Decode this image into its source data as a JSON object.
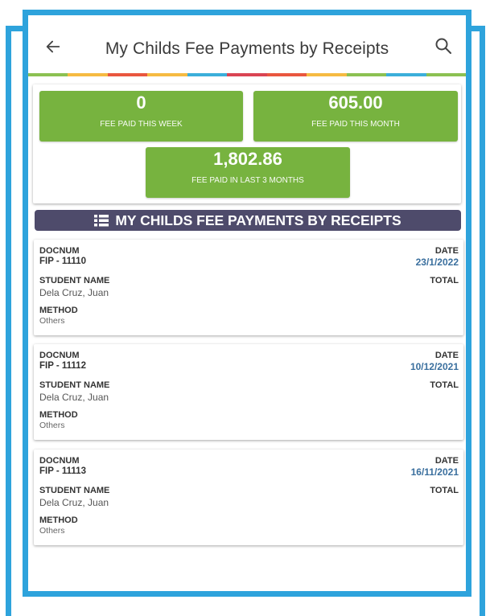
{
  "header": {
    "title": "My Childs Fee Payments by Receipts",
    "back_icon": "arrow-left-icon",
    "search_icon": "search-icon"
  },
  "stripe_colors": [
    "#8cc152",
    "#f6bb42",
    "#e9573f",
    "#f6bb42",
    "#3bafda",
    "#da4453",
    "#e9573f",
    "#f6bb42",
    "#8cc152",
    "#3bafda",
    "#8cc152"
  ],
  "summary": {
    "week": {
      "value": "0",
      "label": "FEE PAID THIS WEEK"
    },
    "month": {
      "value": "605.00",
      "label": "FEE PAID THIS MONTH"
    },
    "three_months": {
      "value": "1,802.86",
      "label": "FEE PAID IN LAST 3 MONTHS"
    }
  },
  "section": {
    "title": "MY CHILDS FEE PAYMENTS BY RECEIPTS",
    "icon": "list-icon"
  },
  "labels": {
    "docnum": "DOCNUM",
    "date": "DATE",
    "student_name": "STUDENT NAME",
    "total": "TOTAL",
    "method": "METHOD"
  },
  "receipts": [
    {
      "docnum": "FIP - 11110",
      "date": "23/1/2022",
      "student": "Dela Cruz, Juan",
      "method": "Others"
    },
    {
      "docnum": "FIP - 11112",
      "date": "10/12/2021",
      "student": "Dela Cruz, Juan",
      "method": "Others"
    },
    {
      "docnum": "FIP - 11113",
      "date": "16/11/2021",
      "student": "Dela Cruz, Juan",
      "method": "Others"
    }
  ],
  "colors": {
    "accent_green": "#77b33f",
    "section_bg": "#4e4b6b",
    "date_blue": "#3a6f9e",
    "frame_blue": "#2ea3dc"
  }
}
